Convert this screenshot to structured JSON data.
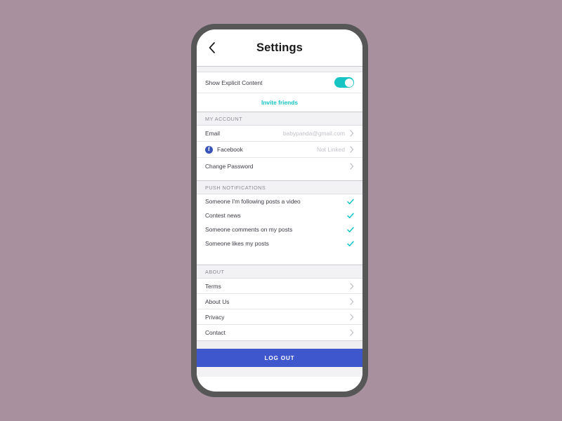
{
  "theme": {
    "page_background": "#a8909f",
    "phone_frame": "#575757",
    "accent_teal": "#16c4c4",
    "accent_blue": "#3e57cd",
    "facebook_blue": "#3a53ba",
    "section_header_bg": "#f2f2f4",
    "muted_text": "#c2c2c9"
  },
  "nav": {
    "back_icon": "chevron-left-icon",
    "title": "Settings"
  },
  "top_section": {
    "explicit": {
      "label": "Show Explicit Content",
      "toggle_state": "on"
    },
    "invite": {
      "label": "Invite friends"
    }
  },
  "my_account": {
    "header": "MY ACCOUNT",
    "rows": [
      {
        "label": "Email",
        "value": "babypanda@gmail.com",
        "accessory": "chevron-right-icon",
        "icon": null
      },
      {
        "label": "Facebook",
        "value": "Not Linked",
        "accessory": "chevron-right-icon",
        "icon": "facebook-icon"
      },
      {
        "label": "Change Password",
        "value": "",
        "accessory": "chevron-right-icon",
        "icon": null
      }
    ]
  },
  "push_notifications": {
    "header": "PUSH NOTIFICATIONS",
    "rows": [
      {
        "label": "Someone I'm following posts a video",
        "checked": true
      },
      {
        "label": "Contest news",
        "checked": true
      },
      {
        "label": "Someone comments on my posts",
        "checked": true
      },
      {
        "label": "Someone likes my posts",
        "checked": true
      }
    ]
  },
  "about": {
    "header": "ABOUT",
    "rows": [
      {
        "label": "Terms",
        "accessory": "chevron-right-icon"
      },
      {
        "label": "About Us",
        "accessory": "chevron-right-icon"
      },
      {
        "label": "Privacy",
        "accessory": "chevron-right-icon"
      },
      {
        "label": "Contact",
        "accessory": "chevron-right-icon"
      }
    ]
  },
  "footer": {
    "logout_label": "LOG OUT"
  }
}
